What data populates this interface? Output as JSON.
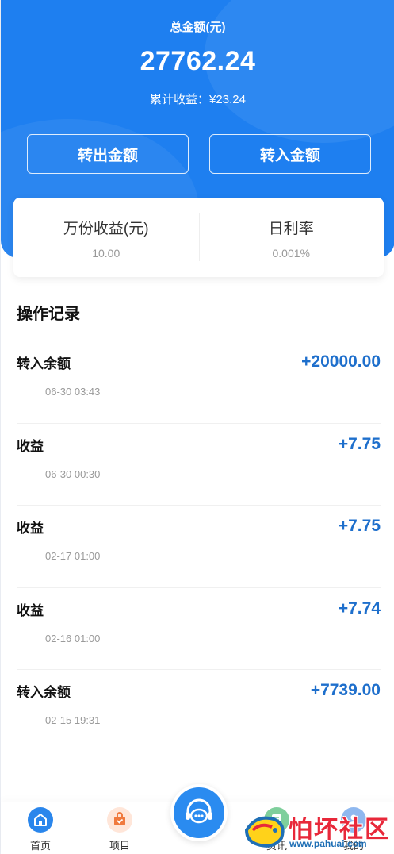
{
  "header": {
    "label": "总金额(元)",
    "total": "27762.24",
    "accumulated": "累计收益：¥23.24",
    "btn_out": "转出金额",
    "btn_in": "转入金额",
    "color": "#1e7ff0"
  },
  "rates": [
    {
      "title": "万份收益(元)",
      "value": "10.00"
    },
    {
      "title": "日利率",
      "value": "0.001%"
    }
  ],
  "records_title": "操作记录",
  "records": [
    {
      "title": "转入余额",
      "time": "06-30 03:43",
      "amount": "+20000.00"
    },
    {
      "title": "收益",
      "time": "06-30 00:30",
      "amount": "+7.75"
    },
    {
      "title": "收益",
      "time": "02-17 01:00",
      "amount": "+7.75"
    },
    {
      "title": "收益",
      "time": "02-16 01:00",
      "amount": "+7.74"
    },
    {
      "title": "转入余额",
      "time": "02-15 19:31",
      "amount": "+7739.00"
    }
  ],
  "tabbar": {
    "home": {
      "label": "首页",
      "icon": "home-icon"
    },
    "project": {
      "label": "项目",
      "icon": "bag-icon"
    },
    "center": {
      "icon": "headset-chat-icon"
    },
    "news": {
      "label": "资讯",
      "icon": "news-icon"
    },
    "mine": {
      "label": "我的",
      "icon": "user-icon"
    }
  },
  "watermark": {
    "text": "怕坏社区",
    "url": "www.pahuai.com"
  }
}
